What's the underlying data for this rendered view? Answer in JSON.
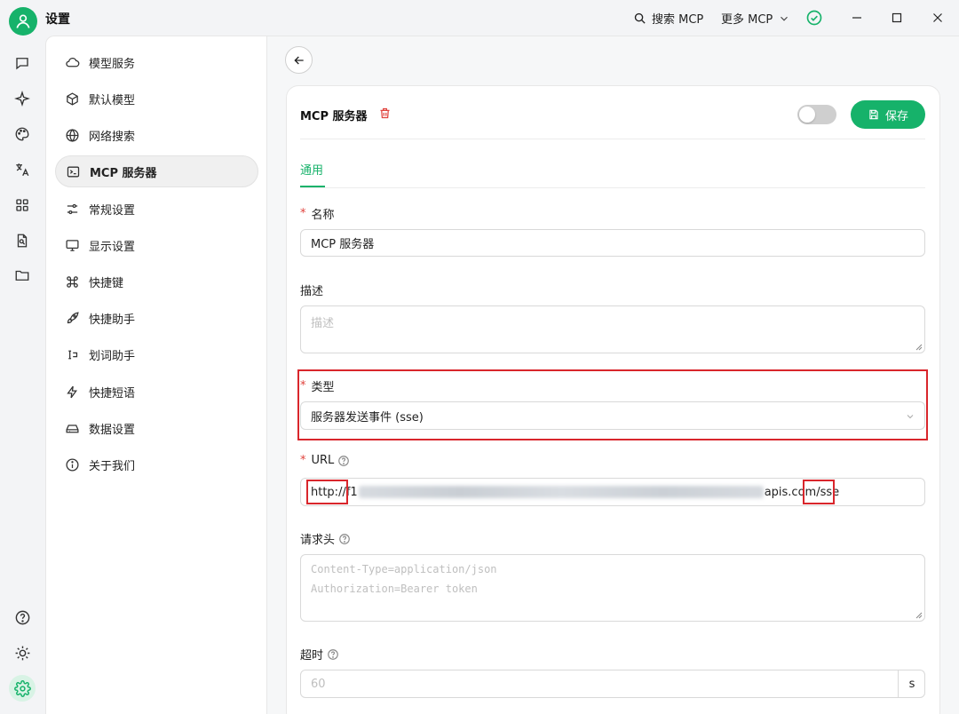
{
  "window": {
    "title": "设置",
    "search_mcp": "搜索 MCP",
    "more_mcp": "更多 MCP"
  },
  "nav": {
    "items": [
      {
        "label": "模型服务"
      },
      {
        "label": "默认模型"
      },
      {
        "label": "网络搜索"
      },
      {
        "label": "MCP 服务器"
      },
      {
        "label": "常规设置"
      },
      {
        "label": "显示设置"
      },
      {
        "label": "快捷键"
      },
      {
        "label": "快捷助手"
      },
      {
        "label": "划词助手"
      },
      {
        "label": "快捷短语"
      },
      {
        "label": "数据设置"
      },
      {
        "label": "关于我们"
      }
    ],
    "active": "MCP 服务器"
  },
  "server": {
    "title": "MCP 服务器",
    "save_label": "保存",
    "enabled": false
  },
  "tabs": [
    {
      "label": "通用"
    }
  ],
  "form": {
    "name_label": "名称",
    "name_value": "MCP 服务器",
    "desc_label": "描述",
    "desc_placeholder": "描述",
    "type_label": "类型",
    "type_value": "服务器发送事件 (sse)",
    "url_label": "URL",
    "url_prefix": "http://",
    "url_start": "f1",
    "url_domain": "apis.com",
    "url_suffix": "/sse",
    "headers_label": "请求头",
    "headers_placeholder_line1": "Content-Type=application/json",
    "headers_placeholder_line2": "Authorization=Bearer token",
    "timeout_label": "超时",
    "timeout_placeholder": "60",
    "timeout_unit": "s"
  },
  "colors": {
    "accent": "#16b26a",
    "required": "#e0423c",
    "highlight": "#d9262c"
  }
}
